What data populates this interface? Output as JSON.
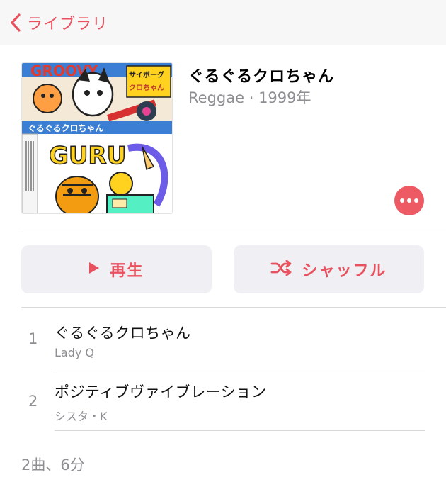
{
  "nav": {
    "back_label": "ライブラリ",
    "back_icon": "chevron-left-icon",
    "accent": "#e8525e"
  },
  "album": {
    "title": "ぐるぐるクロちゃん",
    "genre": "Reggae",
    "separator": " · ",
    "year": "1999年",
    "cover_text": {
      "top": "GROOVY",
      "logo_line1": "サイボーグ",
      "logo_line2": "クロちゃん",
      "band": "ぐるぐるクロちゃん",
      "middle": "GURU"
    }
  },
  "actions": {
    "play_label": "再生",
    "play_icon": "play-icon",
    "shuffle_label": "シャッフル",
    "shuffle_icon": "shuffle-icon",
    "more_icon": "more-icon"
  },
  "tracks": [
    {
      "number": "1",
      "title": "ぐるぐるクロちゃん",
      "artist": "Lady Q"
    },
    {
      "number": "2",
      "title": "ポジティブヴァイブレーション",
      "artist": "シスタ・K"
    }
  ],
  "footer": {
    "summary": "2曲、6分"
  }
}
